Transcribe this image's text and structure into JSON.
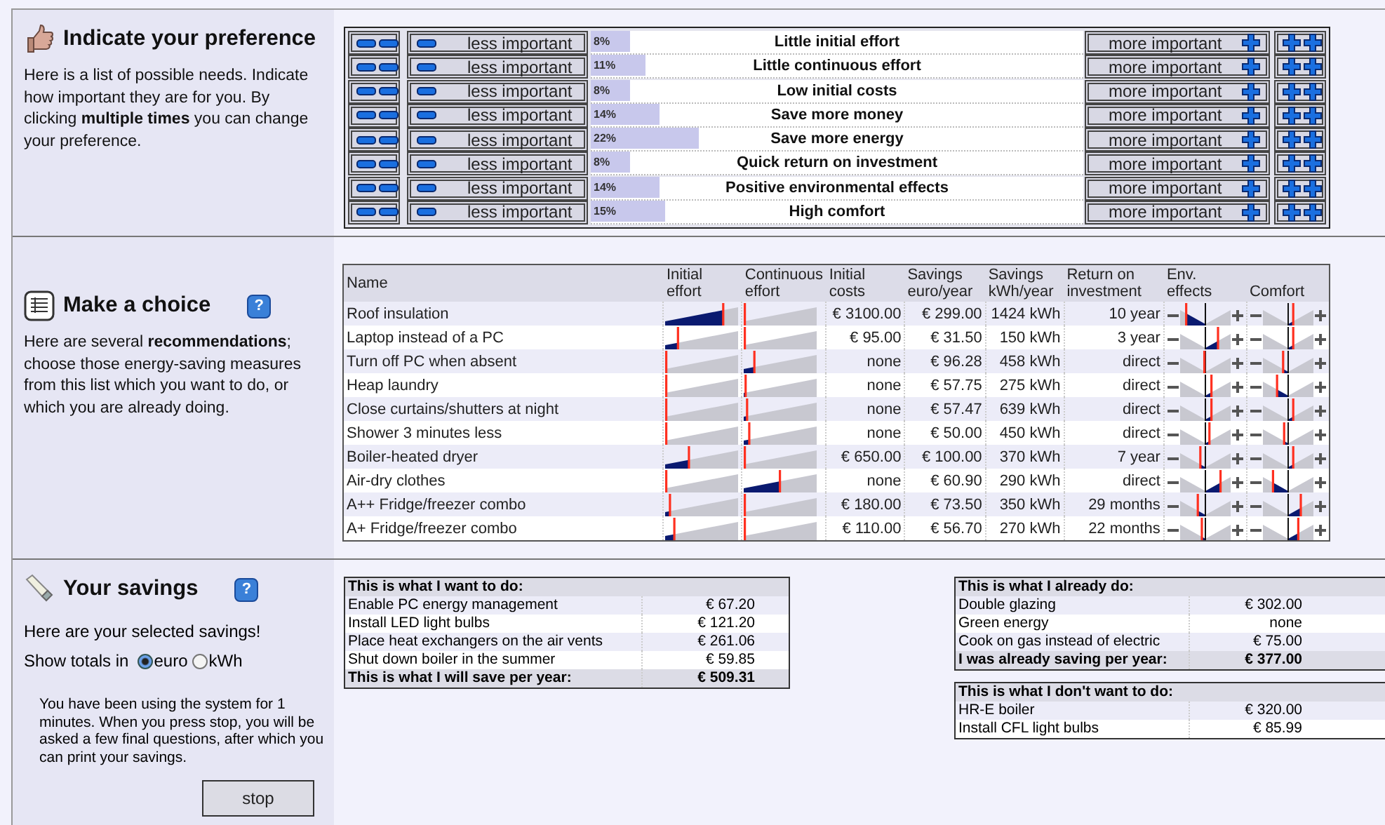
{
  "preference": {
    "title": "Indicate your preference",
    "description": "Here is a list of possible needs. Indicate how important they are for you. By clicking **multiple times** you can change your preference.",
    "rows": [
      {
        "less": "less important",
        "percent": "8%",
        "level": 0.08,
        "label": "Little initial effort",
        "more": "more important"
      },
      {
        "less": "less important",
        "percent": "11%",
        "level": 0.11,
        "label": "Little continuous effort",
        "more": "more important"
      },
      {
        "less": "less important",
        "percent": "8%",
        "level": 0.08,
        "label": "Low initial costs",
        "more": "more important"
      },
      {
        "less": "less important",
        "percent": "14%",
        "level": 0.14,
        "label": "Save more money",
        "more": "more important"
      },
      {
        "less": "less important",
        "percent": "22%",
        "level": 0.22,
        "label": "Save more energy",
        "more": "more important"
      },
      {
        "less": "less important",
        "percent": "8%",
        "level": 0.08,
        "label": "Quick return on investment",
        "more": "more important"
      },
      {
        "less": "less important",
        "percent": "14%",
        "level": 0.14,
        "label": "Positive environmental effects",
        "more": "more important"
      },
      {
        "less": "less important",
        "percent": "15%",
        "level": 0.15,
        "label": "High comfort",
        "more": "more important"
      }
    ]
  },
  "choice": {
    "title": "Make a choice",
    "help": "?",
    "description": "Here are several **recommendations**; choose those energy-saving measures from this list which you want to do, or which you are already doing.",
    "columns": [
      "Name",
      "Initial effort",
      "Continuous effort",
      "Initial costs",
      "Savings euro/year",
      "Savings kWh/year",
      "Return on investment",
      "Env. effects",
      "Comfort"
    ],
    "rows": [
      {
        "name": "Roof insulation",
        "initial_effort": {
          "level": 0.8
        },
        "continuous_effort": {
          "level": 0
        },
        "initial_costs": "€ 3100.00",
        "savings_euro": "€ 299.00",
        "savings_kwh": "1424 kWh",
        "return": "10 year",
        "env_effects": {
          "level": 0.12
        },
        "comfort": {
          "level": 0.6
        }
      },
      {
        "name": "Laptop instead of a PC",
        "initial_effort": {
          "level": 0.18
        },
        "continuous_effort": {
          "level": 0
        },
        "initial_costs": "€ 95.00",
        "savings_euro": "€ 31.50",
        "savings_kwh": "150 kWh",
        "return": "3 year",
        "env_effects": {
          "level": 0.75
        },
        "comfort": {
          "level": 0.6
        }
      },
      {
        "name": "Turn off PC when absent",
        "initial_effort": {
          "level": 0
        },
        "continuous_effort": {
          "level": 0.15
        },
        "initial_costs": "none",
        "savings_euro": "€ 96.28",
        "savings_kwh": "458 kWh",
        "return": "direct",
        "env_effects": {
          "level": 0.48
        },
        "comfort": {
          "level": 0.4
        }
      },
      {
        "name": "Heap laundry",
        "initial_effort": {
          "level": 0
        },
        "continuous_effort": {
          "level": 0.03
        },
        "initial_costs": "none",
        "savings_euro": "€ 57.75",
        "savings_kwh": "275 kWh",
        "return": "direct",
        "env_effects": {
          "level": 0.62
        },
        "comfort": {
          "level": 0.28
        }
      },
      {
        "name": "Close curtains/shutters at night",
        "initial_effort": {
          "level": 0
        },
        "continuous_effort": {
          "level": 0.05
        },
        "initial_costs": "none",
        "savings_euro": "€ 57.47",
        "savings_kwh": "639 kWh",
        "return": "direct",
        "env_effects": {
          "level": 0.62
        },
        "comfort": {
          "level": 0.6
        }
      },
      {
        "name": "Shower 3 minutes less",
        "initial_effort": {
          "level": 0
        },
        "continuous_effort": {
          "level": 0.08
        },
        "initial_costs": "none",
        "savings_euro": "€ 50.00",
        "savings_kwh": "450 kWh",
        "return": "direct",
        "env_effects": {
          "level": 0.58
        },
        "comfort": {
          "level": 0.42
        }
      },
      {
        "name": "Boiler-heated dryer",
        "initial_effort": {
          "level": 0.33
        },
        "continuous_effort": {
          "level": 0
        },
        "initial_costs": "€ 650.00",
        "savings_euro": "€ 100.00",
        "savings_kwh": "370 kWh",
        "return": "7 year",
        "env_effects": {
          "level": 0.4
        },
        "comfort": {
          "level": 0.6
        }
      },
      {
        "name": "Air-dry clothes",
        "initial_effort": {
          "level": 0
        },
        "continuous_effort": {
          "level": 0.5
        },
        "initial_costs": "none",
        "savings_euro": "€ 60.90",
        "savings_kwh": "290 kWh",
        "return": "direct",
        "env_effects": {
          "level": 0.8
        },
        "comfort": {
          "level": 0.2
        }
      },
      {
        "name": "A++ Fridge/freezer combo",
        "initial_effort": {
          "level": 0.07
        },
        "continuous_effort": {
          "level": 0
        },
        "initial_costs": "€ 180.00",
        "savings_euro": "€ 73.50",
        "savings_kwh": "350 kWh",
        "return": "29 months",
        "env_effects": {
          "level": 0.35
        },
        "comfort": {
          "level": 0.75
        }
      },
      {
        "name": "A+ Fridge/freezer combo",
        "initial_effort": {
          "level": 0.13
        },
        "continuous_effort": {
          "level": 0
        },
        "initial_costs": "€ 110.00",
        "savings_euro": "€ 56.70",
        "savings_kwh": "270 kWh",
        "return": "22 months",
        "env_effects": {
          "level": 0.43
        },
        "comfort": {
          "level": 0.7
        }
      }
    ]
  },
  "savings": {
    "title": "Your savings",
    "help": "?",
    "intro": "Here are your selected savings!",
    "totals_label": "Show totals in",
    "units": [
      {
        "label": "euro",
        "selected": true
      },
      {
        "label": "kWh",
        "selected": false
      }
    ],
    "info": "You have been using the system for 1 minutes. When you press stop, you will be asked a few final questions, after which you can print your savings.",
    "stop_button": "stop",
    "want": {
      "title": "This is what I want to do:",
      "rows": [
        {
          "label": "Enable PC energy management",
          "value": "€ 67.20"
        },
        {
          "label": "Install LED light bulbs",
          "value": "€ 121.20"
        },
        {
          "label": "Place heat exchangers on the air vents",
          "value": "€ 261.06"
        },
        {
          "label": "Shut down boiler in the summer",
          "value": "€ 59.85"
        }
      ],
      "total": {
        "label": "This is what I will save per year:",
        "value": "€ 509.31"
      }
    },
    "already": {
      "title": "This is what I already do:",
      "rows": [
        {
          "label": "Double glazing",
          "value": "€ 302.00"
        },
        {
          "label": "Green energy",
          "value": "none"
        },
        {
          "label": "Cook on gas instead of electric",
          "value": "€ 75.00"
        }
      ],
      "total": {
        "label": "I was already saving per year:",
        "value": "€ 377.00"
      }
    },
    "dont_want": {
      "title": "This is what I don't want to do:",
      "rows": [
        {
          "label": "HR-E boiler",
          "value": "€ 320.00"
        },
        {
          "label": "Install CFL light bulbs",
          "value": "€ 85.99"
        }
      ]
    }
  }
}
